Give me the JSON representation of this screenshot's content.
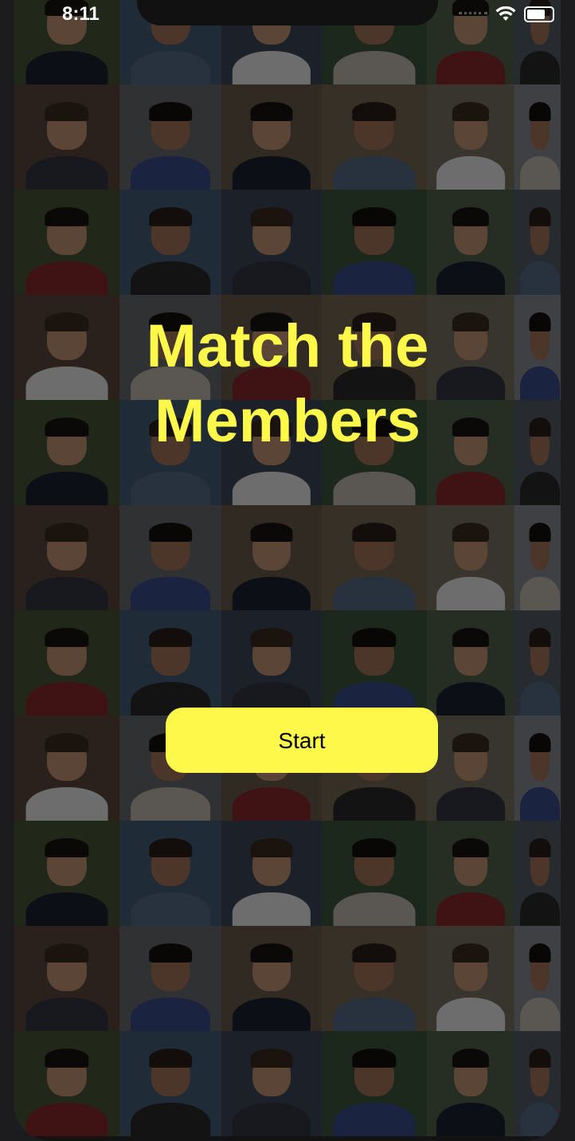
{
  "status_bar": {
    "time": "8:11",
    "icons": [
      "cellular-dots-icon",
      "wifi-icon",
      "battery-icon"
    ],
    "battery_level": 0.85
  },
  "title": "Match the Members",
  "start_button": {
    "label": "Start"
  },
  "colors": {
    "accent": "#fdf84a",
    "background": "#1c1c1e",
    "overlay": "rgba(0,0,0,0.55)"
  },
  "background_tiles": {
    "description_icon": "member-photo-icon",
    "count": 66
  }
}
